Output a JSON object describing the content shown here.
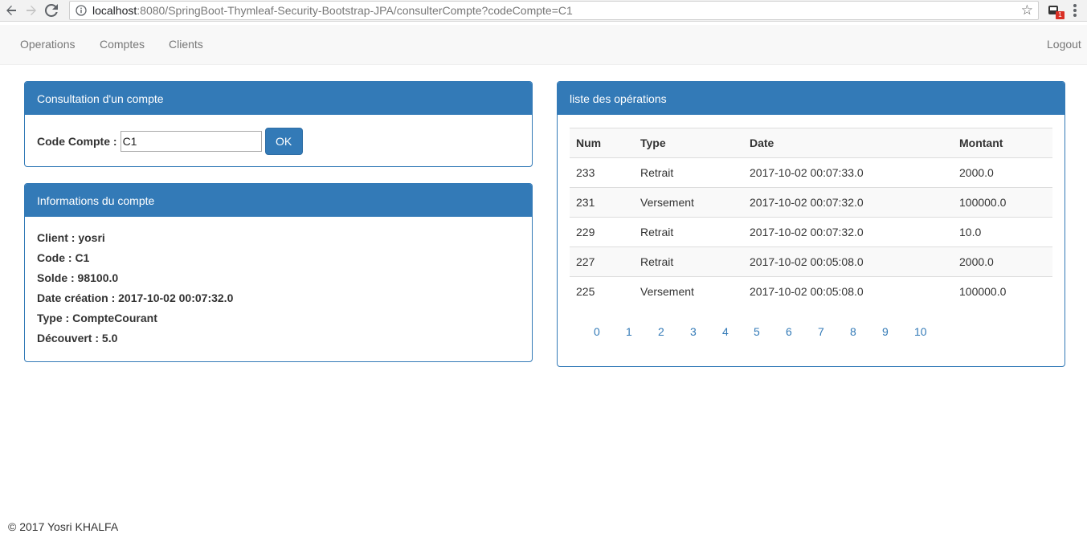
{
  "browser": {
    "url_host": "localhost",
    "url_path": ":8080/SpringBoot-Thymleaf-Security-Bootstrap-JPA/consulterCompte?codeCompte=C1",
    "back_icon": "arrow-left-icon",
    "forward_icon": "arrow-right-icon",
    "reload_icon": "reload-icon",
    "star_icon": "star-icon",
    "extension_badge": "1"
  },
  "navbar": {
    "operations": "Operations",
    "comptes": "Comptes",
    "clients": "Clients",
    "logout": "Logout"
  },
  "consultation": {
    "title": "Consultation d'un compte",
    "code_label": "Code Compte :",
    "code_value": "C1",
    "ok_label": "OK"
  },
  "infos": {
    "title": "Informations du compte",
    "lines": [
      "Client : yosri",
      "Code : C1",
      "Solde : 98100.0",
      "Date création : 2017-10-02 00:07:32.0",
      "Type : CompteCourant",
      "Découvert : 5.0"
    ]
  },
  "operations": {
    "title": "liste des opérations",
    "headers": [
      "Num",
      "Type",
      "Date",
      "Montant"
    ],
    "rows": [
      [
        "233",
        "Retrait",
        "2017-10-02 00:07:33.0",
        "2000.0"
      ],
      [
        "231",
        "Versement",
        "2017-10-02 00:07:32.0",
        "100000.0"
      ],
      [
        "229",
        "Retrait",
        "2017-10-02 00:07:32.0",
        "10.0"
      ],
      [
        "227",
        "Retrait",
        "2017-10-02 00:05:08.0",
        "2000.0"
      ],
      [
        "225",
        "Versement",
        "2017-10-02 00:05:08.0",
        "100000.0"
      ]
    ],
    "pages": [
      "0",
      "1",
      "2",
      "3",
      "4",
      "5",
      "6",
      "7",
      "8",
      "9",
      "10"
    ]
  },
  "footer": {
    "text": "© 2017 Yosri KHALFA"
  },
  "colors": {
    "primary": "#337ab7",
    "navbar_bg": "#f8f8f8",
    "navbar_text": "#777777"
  }
}
